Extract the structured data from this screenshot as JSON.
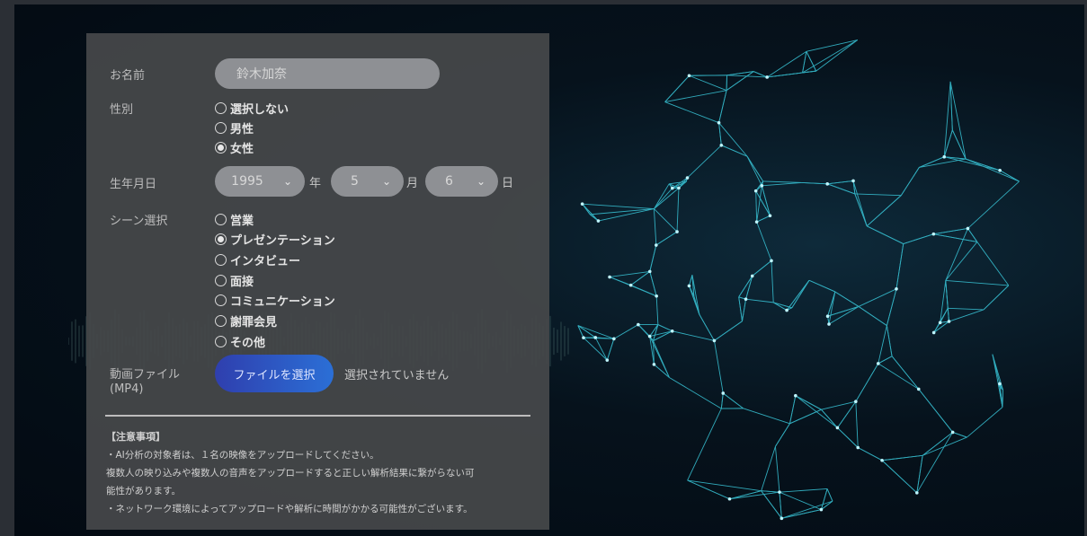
{
  "form": {
    "name": {
      "label": "お名前",
      "value": "鈴木加奈"
    },
    "gender": {
      "label": "性別",
      "options": [
        "選択しない",
        "男性",
        "女性"
      ],
      "selected": "女性"
    },
    "birthdate": {
      "label": "生年月日",
      "year": "1995",
      "year_unit": "年",
      "month": "5",
      "month_unit": "月",
      "day": "6",
      "day_unit": "日"
    },
    "scene": {
      "label": "シーン選択",
      "options": [
        "営業",
        "プレゼンテーション",
        "インタビュー",
        "面接",
        "コミュニケーション",
        "謝罪会見",
        "その他"
      ],
      "selected": "プレゼンテーション"
    },
    "video": {
      "label": "動画ファイル",
      "label_sub": "(MP4)",
      "button": "ファイルを選択",
      "status": "選択されていません"
    }
  },
  "notes": {
    "heading": "【注意事項】",
    "line1": "・AI分析の対象者は、１名の映像をアップロードしてください。",
    "line2": "複数人の映り込みや複数人の音声をアップロードすると正しい解析結果に繋がらない可",
    "line3": "能性があります。",
    "line4": "・ネットワーク環境によってアップロードや解析に時間がかかる可能性がございます。"
  },
  "colors": {
    "accent_start": "#2f3fae",
    "accent_end": "#2b6fd6",
    "mesh": "#3fd0e0"
  },
  "icons": [
    "chevron-down-icon",
    "radio-icon"
  ]
}
